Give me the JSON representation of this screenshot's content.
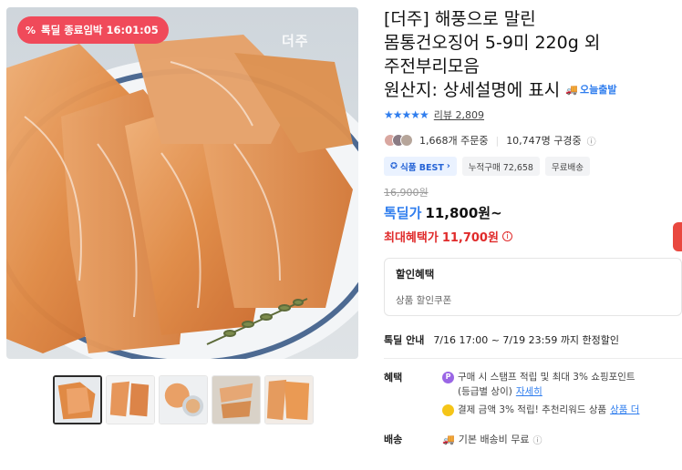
{
  "badge": {
    "icon": "percent-icon",
    "text": "톡딜 종료임박 16:01:05"
  },
  "brand_mark": "더주",
  "title": {
    "line1": "[더주] 해풍으로 말린",
    "line2": "몸통건오징어 5-9미 220g 외",
    "line3": "주전부리모음",
    "line4": "원산지: 상세설명에 표시"
  },
  "delivery_tag": "오늘출발",
  "rating": {
    "stars": "★★★★★",
    "review_label": "리뷰 2,809"
  },
  "stats": {
    "orders": "1,668개 주문중",
    "views": "10,747명 구경중"
  },
  "tags": [
    {
      "text": "식품 BEST",
      "icon": "shield-icon"
    },
    {
      "text": "누적구매 72,658"
    },
    {
      "text": "무료배송"
    }
  ],
  "price": {
    "original": "16,900원",
    "deal_label": "톡딜가",
    "deal_price": "11,800원~",
    "max_label": "최대혜택가",
    "max_price": "11,700원"
  },
  "discount_box": {
    "title": "할인혜택",
    "subtitle": "상품 할인쿠폰"
  },
  "deal_info": {
    "label": "톡딜 안내",
    "value": "7/16 17:00 ~ 7/19 23:59 까지 한정할인"
  },
  "benefit": {
    "label": "혜택",
    "line1": "구매 시 스탬프 적립 및 최대 3% 쇼핑포인트",
    "line2": "(등급별 상이)",
    "line2_link": "자세히",
    "line3": "결제 금액 3% 적립! 추천리워드 상품",
    "line3_link": "상품 더"
  },
  "shipping": {
    "label": "배송",
    "value": "기본 배송비 무료"
  },
  "colors": {
    "accent_blue": "#2f7dee",
    "deal_red": "#f04a5a",
    "price_red": "#e02b2b"
  }
}
